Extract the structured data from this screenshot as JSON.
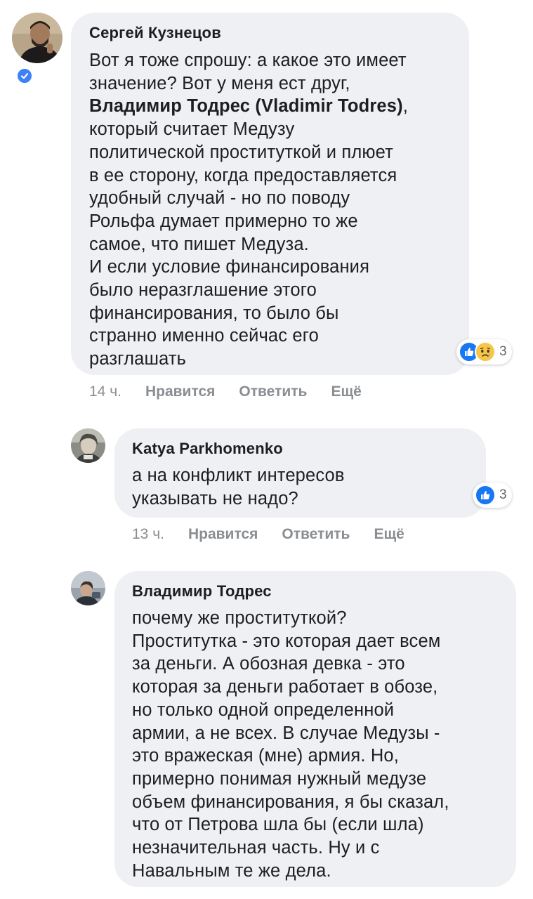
{
  "comments": [
    {
      "author": "Сергей Кузнецов",
      "verified_icon": "verified-check-icon",
      "text_part1": "Вот я тоже спрошу: а какое это имеет\nзначение? Вот у меня ест друг,\n",
      "mention": "Владимир Тодрес (Vladimir Todres)",
      "text_part2": ",\nкоторый считает Медузу\nполитической проституткой и плюет\nв ее сторону, когда предоставляется\nудобный случай - но по поводу\nРольфа думает примерно то же\nсамое, что пишет Медуза.\nИ если условие финансирования\nбыло неразглашение этого\nфинансирования, то было бы\nстранно именно сейчас его\nразглашать",
      "reactions": {
        "icons": [
          "like-icon",
          "sad-icon"
        ],
        "count": "3"
      },
      "time": "14 ч.",
      "like_label": "Нравится",
      "reply_label": "Ответить",
      "more_label": "Ещё"
    },
    {
      "author": "Katya Parkhomenko",
      "text": "а на конфликт интересов\nуказывать не надо?",
      "reactions": {
        "icons": [
          "like-icon"
        ],
        "count": "3"
      },
      "time": "13 ч.",
      "like_label": "Нравится",
      "reply_label": "Ответить",
      "more_label": "Ещё"
    },
    {
      "author": "Владимир Тодрес",
      "text": "почему же проституткой?\nПроститутка - это которая дает всем\nза деньги. А обозная девка - это\nкоторая за деньги работает в обозе,\nно только одной определенной\nармии, а не всех. В случае Медузы -\nэто вражеская (мне) армия. Но,\nпримерно понимая нужный медузе\nобъем финансирования, я бы сказал,\nчто от Петрова шла бы (если шла)\nнезначительная часть. Ну и с\nНавальным те же дела."
    }
  ],
  "colors": {
    "bubble": "#eff0f3",
    "text": "#1c1e21",
    "meta": "#8a8d91",
    "like_blue": "#1877f2",
    "verified_blue": "#3c82f6",
    "sad_yellow": "#f7c54a"
  }
}
